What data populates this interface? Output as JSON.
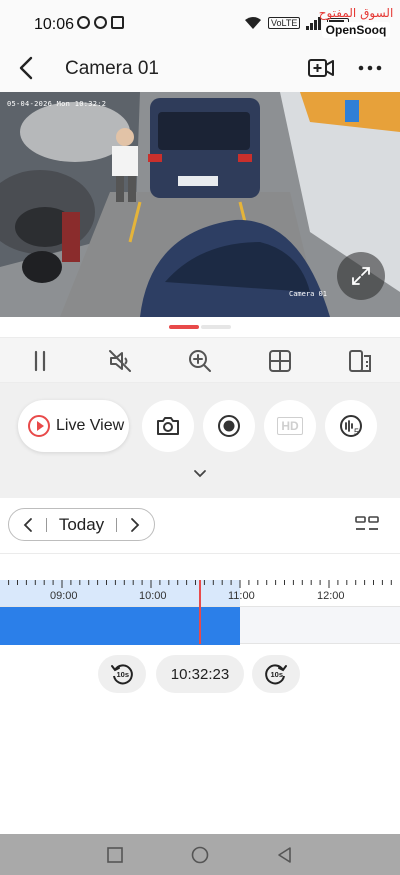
{
  "status_bar": {
    "time": "10:06",
    "network": "VoLTE",
    "watermark_arabic": "السوق المفتوح",
    "watermark_brand": "OpenSooq"
  },
  "header": {
    "title": "Camera 01",
    "icons": {
      "back": "back-arrow-icon",
      "add_camera": "video-camera-add-icon",
      "more": "more-dots-icon"
    }
  },
  "video": {
    "osd_date": "05-04-2026 Mon 10:32:2",
    "osd_camera": "Camera 01",
    "icons": {
      "fullscreen": "expand-arrows-icon"
    }
  },
  "page_indicator": {
    "active_index": 0,
    "count": 2,
    "active_color": "#e84a4a"
  },
  "controls": {
    "icons": [
      "pause-icon",
      "mute-icon",
      "zoom-in-icon",
      "grid-icon",
      "screen-switch-icon"
    ]
  },
  "modes": {
    "live_view_label": "Live View",
    "hd_label": "HD",
    "icons": [
      "play-circle-icon",
      "camera-icon",
      "record-icon",
      "hd-icon",
      "sound-5-icon",
      "chevron-down-icon"
    ]
  },
  "playback": {
    "date_label": "Today",
    "timeline_labels": [
      "09:00",
      "10:00",
      "11:00",
      "12:00"
    ],
    "current_time": "10:32:23",
    "skip_back_label": "10s",
    "skip_forward_label": "10s",
    "recording_until": "11:00",
    "record_color": "#2b7fe9"
  },
  "nav_bar": {
    "icons": [
      "recents-square-icon",
      "home-circle-icon",
      "back-triangle-icon"
    ]
  }
}
